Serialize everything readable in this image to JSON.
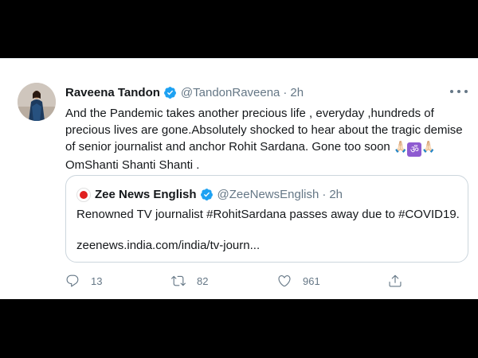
{
  "tweet": {
    "author_name": "Raveena Tandon",
    "author_handle": "@TandonRaveena",
    "separator": "·",
    "time": "2h",
    "text_lines": [
      "And the Pandemic takes another precious life , everyday ,hundreds of",
      "precious lives are gone.Absolutely shocked to hear about the tragic demise",
      "of senior journalist and anchor Rohit Sardana. Gone too soon",
      "OmShanti Shanti Shanti ."
    ],
    "emojis": {
      "pray_1": "🙏🏻",
      "om": "ॐ",
      "pray_2": "🙏🏻"
    }
  },
  "quoted_tweet": {
    "author_name": "Zee News English",
    "author_handle": "@ZeeNewsEnglish",
    "separator": "·",
    "time": "2h",
    "text": "Renowned TV journalist #RohitSardana passes away due to #COVID19.",
    "link": "zeenews.india.com/india/tv-journ..."
  },
  "actions": {
    "replies": "13",
    "retweets": "82",
    "likes": "961"
  },
  "icons": [
    "verified-badge-icon",
    "more-options-icon",
    "reply-icon",
    "retweet-icon",
    "like-icon",
    "share-icon"
  ],
  "colors": {
    "verified": "#1da1f2",
    "secondary_text": "#657786",
    "primary_text": "#14171a",
    "border": "#ccd6dd",
    "om_badge": "#8e5bd1"
  }
}
